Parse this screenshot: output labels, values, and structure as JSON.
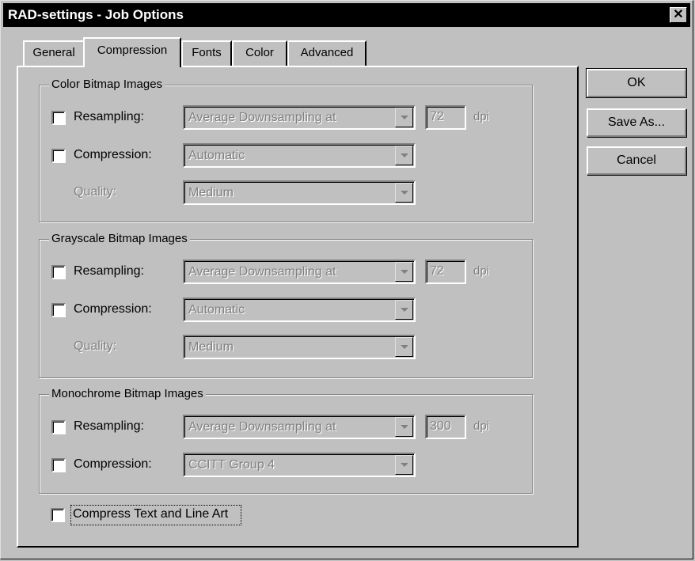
{
  "window": {
    "title": "RAD-settings - Job Options",
    "close_glyph": "✕"
  },
  "tabs": [
    {
      "label": "General",
      "active": false
    },
    {
      "label": "Compression",
      "active": true
    },
    {
      "label": "Fonts",
      "active": false
    },
    {
      "label": "Color",
      "active": false
    },
    {
      "label": "Advanced",
      "active": false
    }
  ],
  "color_group": {
    "title": "Color Bitmap Images",
    "resampling": {
      "label": "Resampling:",
      "checked": false,
      "method": "Average Downsampling at",
      "dpi": "72",
      "unit": "dpi"
    },
    "compression": {
      "label": "Compression:",
      "checked": false,
      "value": "Automatic"
    },
    "quality": {
      "label": "Quality:",
      "value": "Medium"
    }
  },
  "gray_group": {
    "title": "Grayscale Bitmap Images",
    "resampling": {
      "label": "Resampling:",
      "checked": false,
      "method": "Average Downsampling at",
      "dpi": "72",
      "unit": "dpi"
    },
    "compression": {
      "label": "Compression:",
      "checked": false,
      "value": "Automatic"
    },
    "quality": {
      "label": "Quality:",
      "value": "Medium"
    }
  },
  "mono_group": {
    "title": "Monochrome Bitmap Images",
    "resampling": {
      "label": "Resampling:",
      "checked": false,
      "method": "Average Downsampling at",
      "dpi": "300",
      "unit": "dpi"
    },
    "compression": {
      "label": "Compression:",
      "checked": false,
      "value": "CCITT Group 4"
    }
  },
  "compress_text": {
    "label": "Compress Text and Line Art",
    "checked": false
  },
  "buttons": {
    "ok": "OK",
    "save_as": "Save As...",
    "cancel": "Cancel"
  },
  "colors": {
    "face": "#c0c0c0",
    "titlebar": "#000000",
    "disabled_text": "#808080"
  }
}
